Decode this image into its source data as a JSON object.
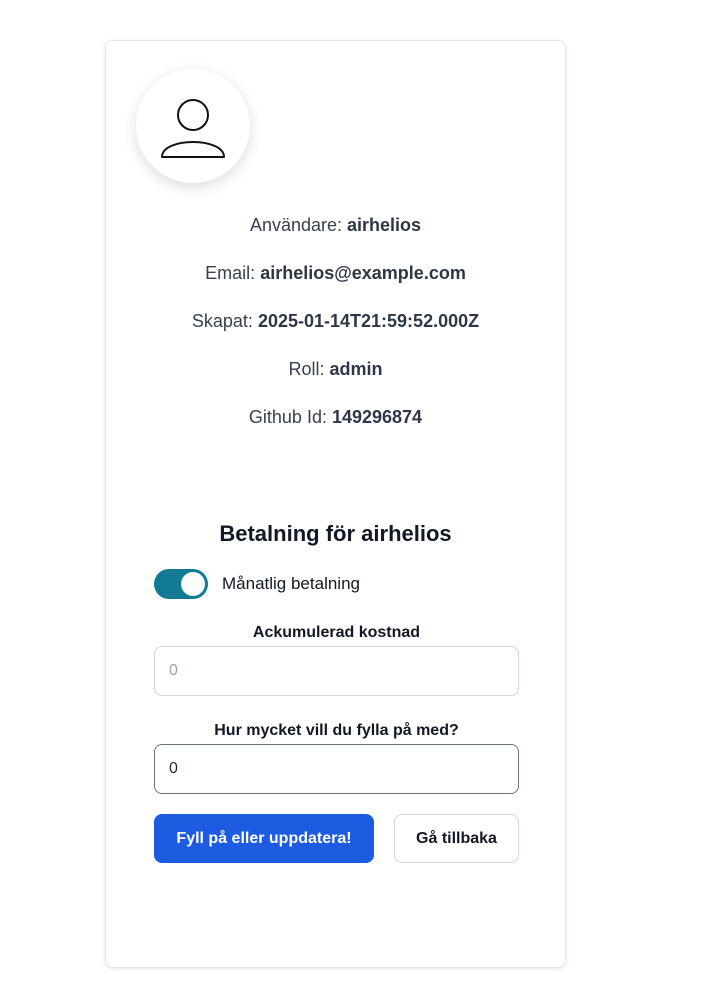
{
  "profile": {
    "user_label": "Användare:",
    "user_value": "airhelios",
    "email_label": "Email:",
    "email_value": "airhelios@example.com",
    "created_label": "Skapat:",
    "created_value": "2025-01-14T21:59:52.000Z",
    "role_label": "Roll:",
    "role_value": "admin",
    "github_label": "Github Id:",
    "github_value": "149296874"
  },
  "payment": {
    "title_prefix": "Betalning för",
    "title_user": "airhelios",
    "monthly_label": "Månatlig betalning",
    "monthly_enabled": true,
    "accumulated_label": "Ackumulerad kostnad",
    "accumulated_placeholder": "0",
    "topup_label": "Hur mycket vill du fylla på med?",
    "topup_value": "0",
    "submit_label": "Fyll på eller uppdatera!",
    "back_label": "Gå tillbaka"
  },
  "icons": {
    "avatar": "user-icon"
  },
  "colors": {
    "toggle_on": "#137a95",
    "primary_button": "#1d5ce0"
  }
}
